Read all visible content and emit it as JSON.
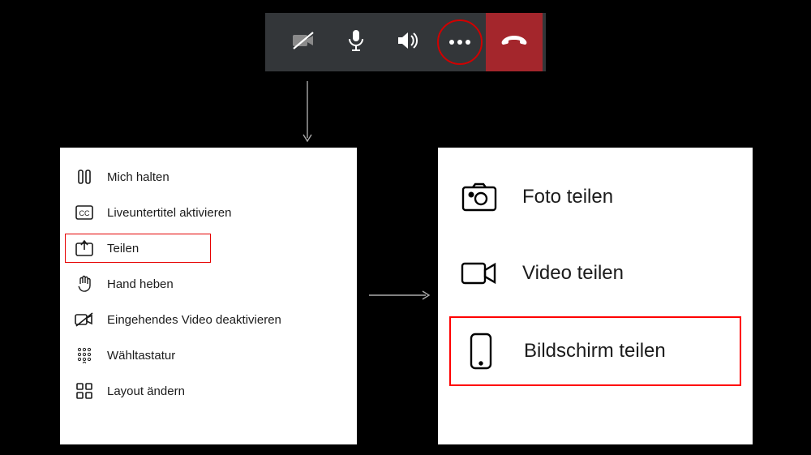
{
  "toolbar": {
    "buttons": {
      "camera_off": "camera-off-icon",
      "mic": "microphone-icon",
      "speaker": "speaker-icon",
      "more": "more-options-icon",
      "hangup": "hangup-icon"
    },
    "highlighted": "more"
  },
  "more_menu": {
    "items": [
      {
        "icon": "hold-icon",
        "label": "Mich halten"
      },
      {
        "icon": "cc-icon",
        "label": "Liveuntertitel aktivieren"
      },
      {
        "icon": "share-up-icon",
        "label": "Teilen",
        "highlighted": true
      },
      {
        "icon": "raise-hand-icon",
        "label": "Hand heben"
      },
      {
        "icon": "video-off-icon",
        "label": "Eingehendes Video deaktivieren"
      },
      {
        "icon": "dialpad-icon",
        "label": "Wähltastatur"
      },
      {
        "icon": "layout-icon",
        "label": "Layout ändern"
      }
    ]
  },
  "share_submenu": {
    "items": [
      {
        "icon": "photo-icon",
        "label": "Foto teilen"
      },
      {
        "icon": "video-icon",
        "label": "Video teilen"
      },
      {
        "icon": "screen-icon",
        "label": "Bildschirm teilen",
        "highlighted": true
      }
    ]
  },
  "colors": {
    "toolbar_bg": "#333639",
    "hangup_bg": "#a4262c",
    "highlight_red": "#e60000"
  }
}
